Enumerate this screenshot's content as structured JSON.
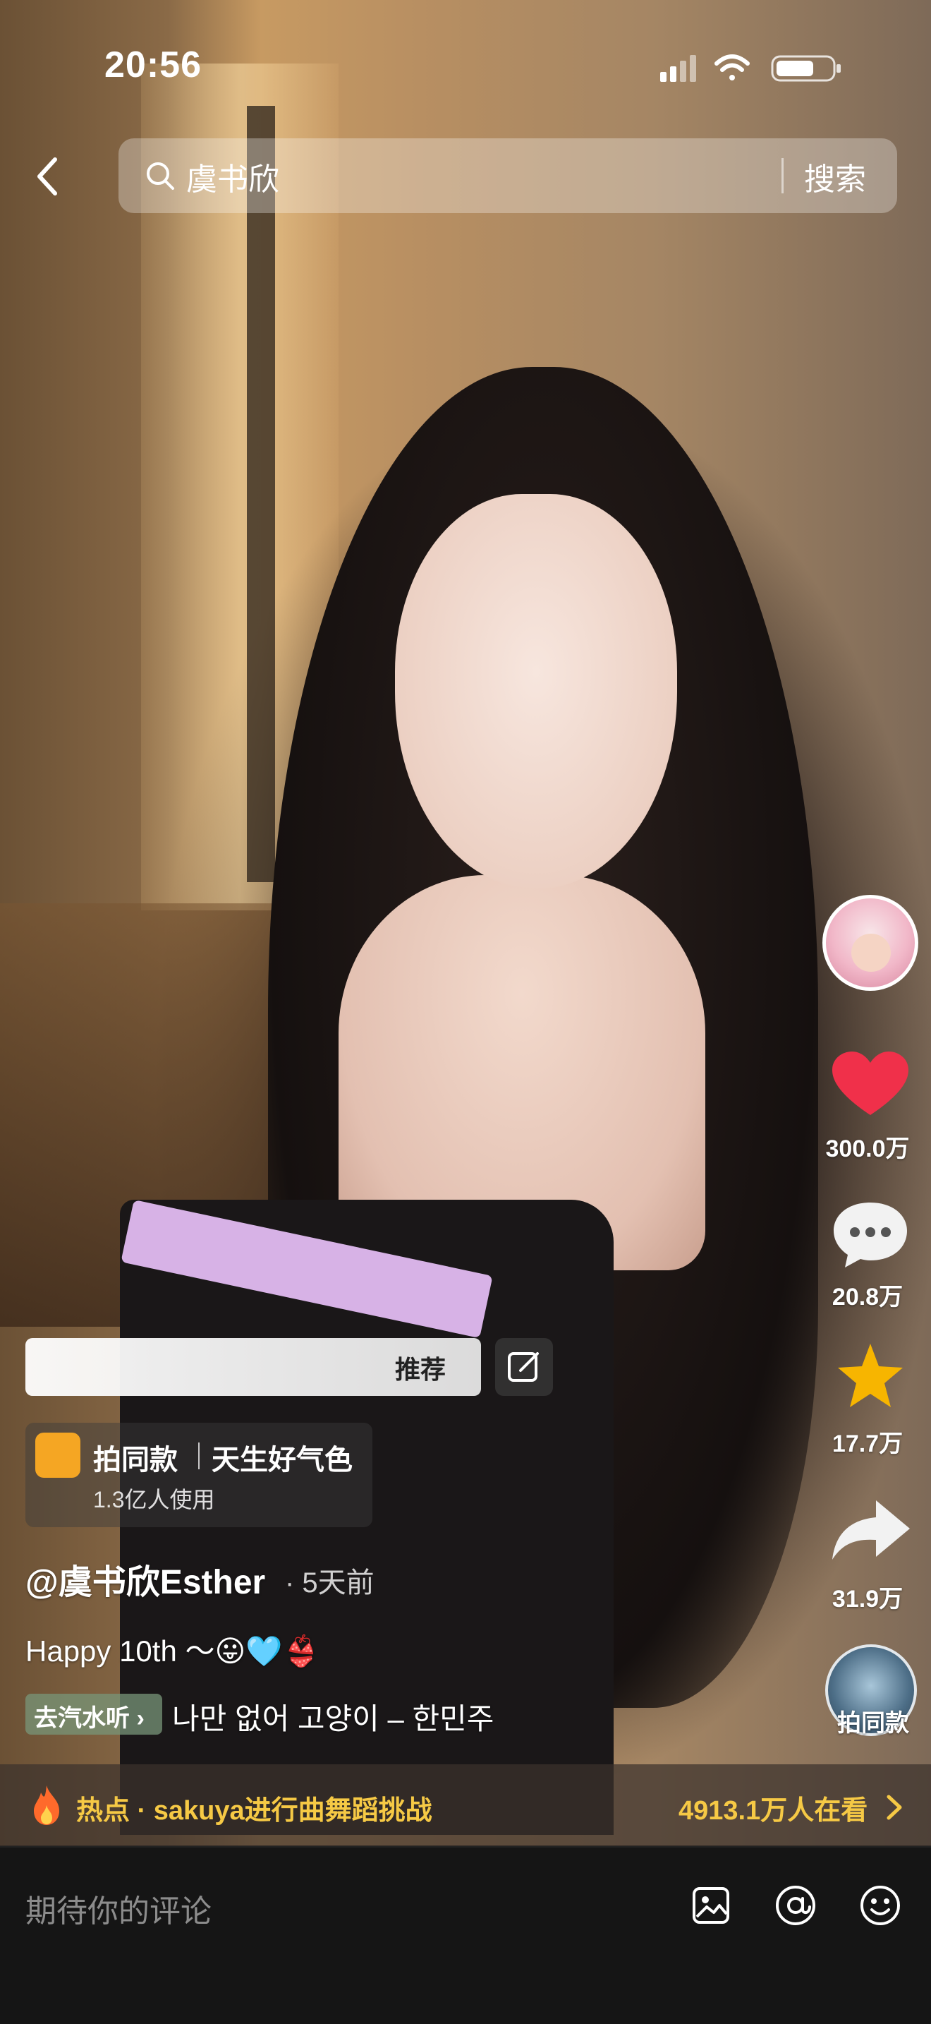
{
  "status": {
    "time": "20:56"
  },
  "search": {
    "query": "虞书欣",
    "button": "搜索"
  },
  "actions": {
    "likes": "300.0万",
    "comments": "20.8万",
    "favorites": "17.7万",
    "shares": "31.9万",
    "music_label": "拍同款"
  },
  "banner": {
    "text": "推荐"
  },
  "effect": {
    "title": "拍同款",
    "name": "天生好气色",
    "usage": "1.3亿人使用"
  },
  "post": {
    "author": "@虞书欣Esther",
    "time": "· 5天前",
    "caption": "Happy 10th ～😛🩵👙"
  },
  "music": {
    "pill": "去汽水听 ›",
    "title": "나만 없어 고양이 – 한민주"
  },
  "hot": {
    "text": "热点 · sakuya进行曲舞蹈挑战",
    "count": "4913.1万人在看"
  },
  "comment": {
    "placeholder": "期待你的评论"
  },
  "colors": {
    "accent_yellow": "#f6c945",
    "like_red": "#f0304a",
    "favorite_yellow": "#f7b500"
  }
}
